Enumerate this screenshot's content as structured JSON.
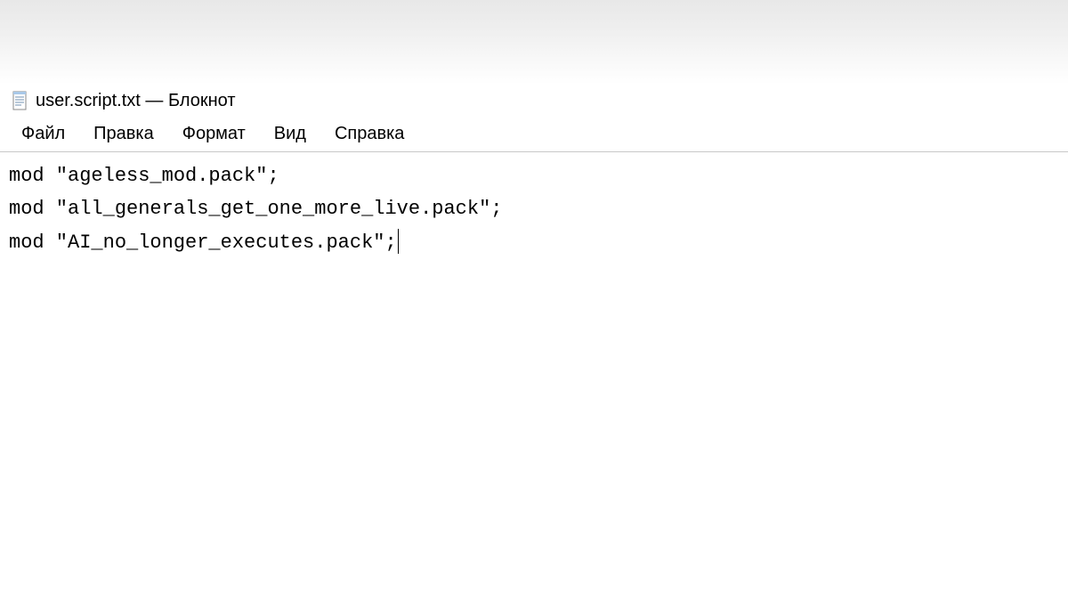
{
  "titlebar": {
    "filename": "user.script.txt",
    "separator": "—",
    "app_name": "Блокнот"
  },
  "menu": {
    "file": "Файл",
    "edit": "Правка",
    "format": "Формат",
    "view": "Вид",
    "help": "Справка"
  },
  "content": {
    "lines": [
      "mod \"ageless_mod.pack\";",
      "mod \"all_generals_get_one_more_live.pack\";",
      "mod \"AI_no_longer_executes.pack\";"
    ]
  }
}
